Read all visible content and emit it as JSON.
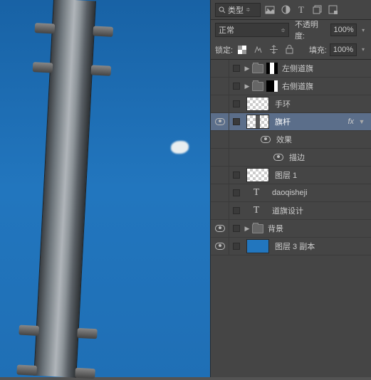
{
  "toolbar": {
    "filter_label": "类型",
    "filter_icon": "search-icon",
    "blend_mode": "正常",
    "opacity_label": "不透明度:",
    "opacity_value": "100%",
    "lock_label": "锁定:",
    "fill_label": "填充:",
    "fill_value": "100%"
  },
  "layers": [
    {
      "id": "left-flag",
      "name": "左侧道旗",
      "visible": false,
      "check": true,
      "group": true,
      "triangle": true,
      "mask": "m1"
    },
    {
      "id": "right-flag",
      "name": "右侧道旗",
      "visible": false,
      "check": true,
      "group": true,
      "triangle": true,
      "mask": "m2"
    },
    {
      "id": "ring",
      "name": "手环",
      "visible": false,
      "check": true,
      "thumb": "checker"
    },
    {
      "id": "pole",
      "name": "旗杆",
      "visible": true,
      "check": true,
      "thumb": "checker selpole",
      "selected": true,
      "fx": true,
      "tridown": true
    },
    {
      "id": "effects",
      "name": "效果",
      "visible": true,
      "sub": 1
    },
    {
      "id": "stroke",
      "name": "描边",
      "visible": true,
      "sub": 2
    },
    {
      "id": "layer1",
      "name": "图层 1",
      "visible": false,
      "check": true,
      "thumb": "checker"
    },
    {
      "id": "daoqisheji-en",
      "name": "daoqisheji",
      "visible": false,
      "check": true,
      "text": true
    },
    {
      "id": "daoqisheji-cn",
      "name": "道旗设计",
      "visible": false,
      "check": true,
      "text": true
    },
    {
      "id": "bg",
      "name": "背景",
      "visible": true,
      "check": true,
      "group": true,
      "triangle": true
    },
    {
      "id": "layer3copy",
      "name": "图层 3 副本",
      "visible": true,
      "check": true,
      "thumb": "sky"
    }
  ],
  "text_layer_icon": "T",
  "fx_label": "fx",
  "triangle_right": "▶",
  "triangle_down": "▼"
}
